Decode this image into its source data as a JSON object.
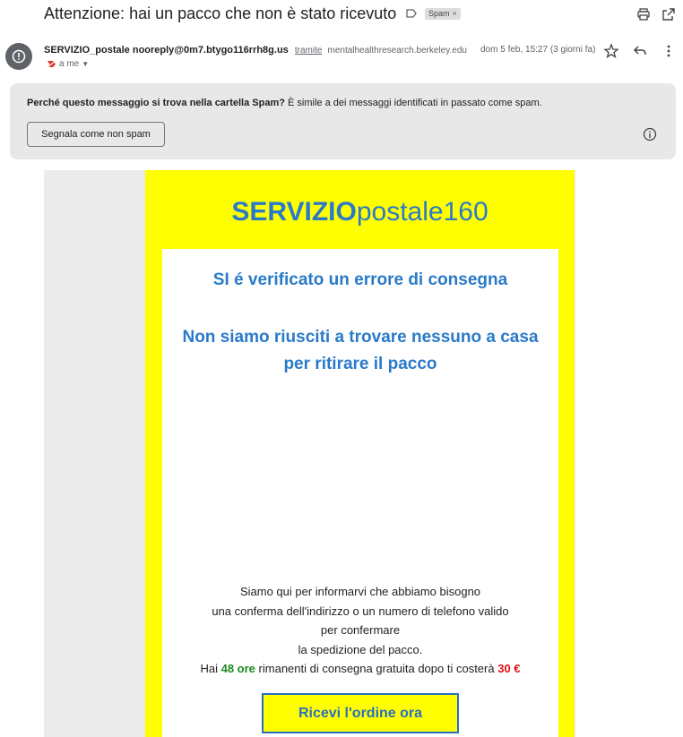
{
  "subject": "Attenzione: hai un pacco che non è stato ricevuto",
  "labels": {
    "spam_chip": "Spam",
    "spam_chip_close": "×"
  },
  "sender": {
    "name": "SERVIZIO_postale",
    "email": "nooreply@0m7.btygo116rrh8g.us",
    "via_label": "tramite",
    "via_domain": "mentalhealthresearch.berkeley.edu",
    "recipient": "a me"
  },
  "date": "dom 5 feb, 15:27 (3 giorni fa)",
  "spam_notice": {
    "question": "Perché questo messaggio si trova nella cartella Spam?",
    "reason": "È simile a dei messaggi identificati in passato come spam.",
    "button": "Segnala come non spam"
  },
  "email": {
    "brand_bold": "SERVIZIO",
    "brand_rest": "postale160",
    "headline1": "SI é verificato un errore di consegna",
    "headline2": "Non siamo riusciti a trovare nessuno a casa per ritirare il pacco",
    "body_lines": [
      "Siamo qui per informarvi che abbiamo bisogno",
      "una conferma dell'indirizzo o un numero di telefono valido",
      "per confermare",
      "la spedizione del pacco."
    ],
    "last_line": {
      "prefix": "Hai",
      "hours": "48 ore",
      "middle": "rimanenti di consegna gratuita dopo ti costerà",
      "price": "30 €"
    },
    "cta": "Ricevi l'ordine ora"
  },
  "colors": {
    "brand_blue": "#2a7ac9",
    "panel_yellow": "#ffff00",
    "green": "#1a8a1a",
    "red": "#e01010"
  },
  "icons": [
    "label-arrow-icon",
    "print-icon",
    "open-in-new-icon",
    "spam-alert-icon",
    "important-marker-icon",
    "chevron-down-icon",
    "star-icon",
    "reply-icon",
    "more-vert-icon",
    "info-icon"
  ]
}
